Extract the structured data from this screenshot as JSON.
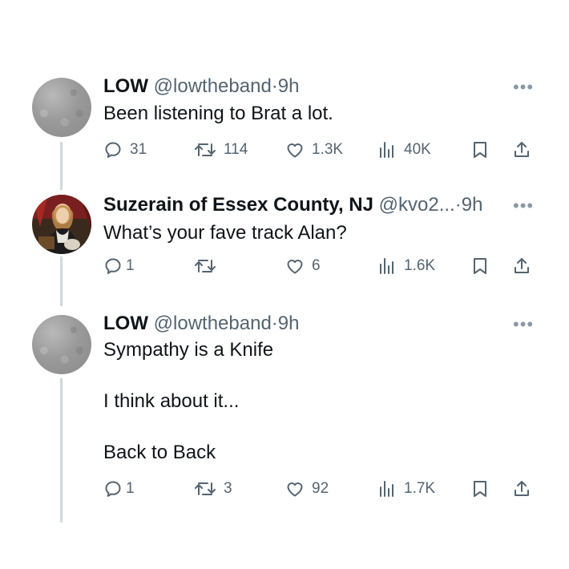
{
  "tweets": [
    {
      "name": "LOW",
      "handle": "@lowtheband",
      "separator": "·",
      "time": "9h",
      "lines": [
        "Been listening to Brat a lot."
      ],
      "replies": "31",
      "reposts": "114",
      "likes": "1.3K",
      "views": "40K"
    },
    {
      "name": "Suzerain of Essex County, NJ",
      "handle": "@kvo2...",
      "separator": "·",
      "time": "9h",
      "lines": [
        "What’s your fave track Alan?"
      ],
      "replies": "1",
      "reposts": "",
      "likes": "6",
      "views": "1.6K"
    },
    {
      "name": "LOW",
      "handle": "@lowtheband",
      "separator": "·",
      "time": "9h",
      "lines": [
        "Sympathy is a Knife",
        "",
        "I think about it...",
        "",
        "Back to Back"
      ],
      "replies": "1",
      "reposts": "3",
      "likes": "92",
      "views": "1.7K"
    }
  ],
  "more_glyph": "•••",
  "icons": {
    "reply": "reply-icon",
    "repost": "repost-icon",
    "like": "heart-icon",
    "views": "views-icon",
    "bookmark": "bookmark-icon",
    "share": "share-icon"
  },
  "colors": {
    "text": "#0f1419",
    "secondary": "#536471",
    "thread_line": "#cfd9de"
  }
}
